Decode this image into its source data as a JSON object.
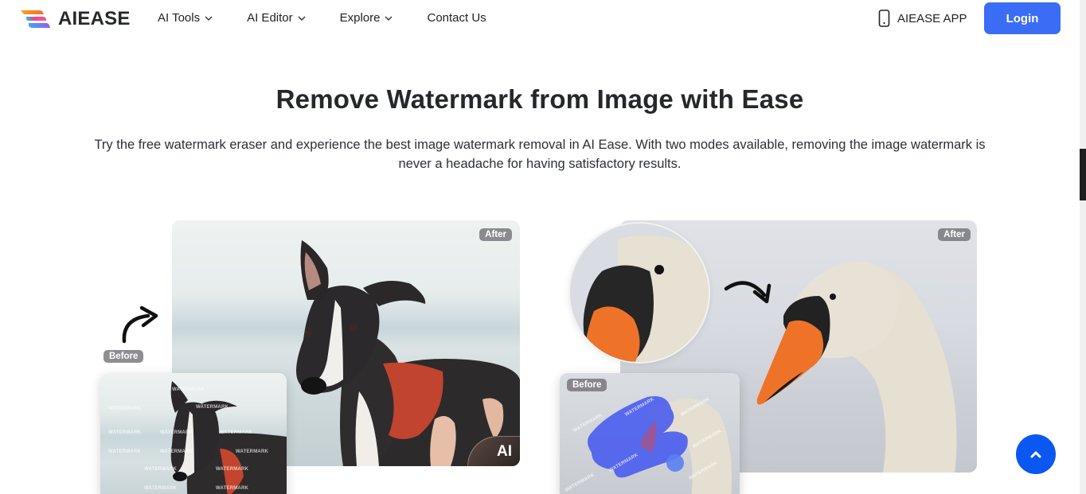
{
  "header": {
    "logo_text": "AIEASE",
    "nav": [
      {
        "label": "AI Tools",
        "has_dropdown": true
      },
      {
        "label": "AI Editor",
        "has_dropdown": true
      },
      {
        "label": "Explore",
        "has_dropdown": true
      },
      {
        "label": "Contact Us",
        "has_dropdown": false
      }
    ],
    "app_link": "AIEASE APP",
    "login_label": "Login"
  },
  "hero": {
    "title": "Remove Watermark from Image with Ease",
    "subtitle": "Try the free watermark eraser and experience the best image watermark removal in AI Ease. With two modes available, removing the image watermark is never a headache for having satisfactory results."
  },
  "examples": [
    {
      "subject": "dog",
      "before_label": "Before",
      "after_label": "After",
      "mode_badge": "AI",
      "watermark_text": "WATERMARK"
    },
    {
      "subject": "swan",
      "before_label": "Before",
      "after_label": "After",
      "watermark_text": "WATERMARK"
    }
  ],
  "colors": {
    "brand_blue": "#3a6cf6",
    "back_to_top": "#0b57f2",
    "brush_overlay": "#3c50f0"
  },
  "icons": {
    "app": "smartphone-icon",
    "nav_dropdown": "chevron-down-icon",
    "back_to_top": "chevron-up-icon"
  }
}
